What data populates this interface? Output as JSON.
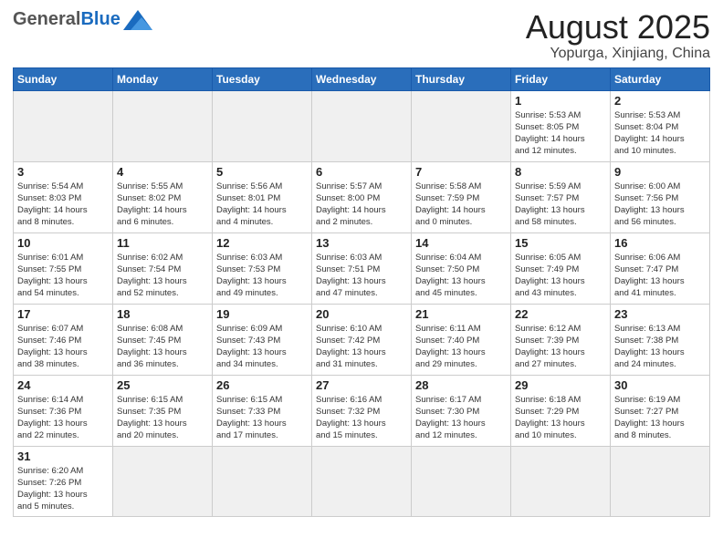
{
  "header": {
    "logo_general": "General",
    "logo_blue": "Blue",
    "month": "August 2025",
    "location": "Yopurga, Xinjiang, China"
  },
  "days_of_week": [
    "Sunday",
    "Monday",
    "Tuesday",
    "Wednesday",
    "Thursday",
    "Friday",
    "Saturday"
  ],
  "weeks": [
    [
      {
        "day": "",
        "info": ""
      },
      {
        "day": "",
        "info": ""
      },
      {
        "day": "",
        "info": ""
      },
      {
        "day": "",
        "info": ""
      },
      {
        "day": "",
        "info": ""
      },
      {
        "day": "1",
        "info": "Sunrise: 5:53 AM\nSunset: 8:05 PM\nDaylight: 14 hours\nand 12 minutes."
      },
      {
        "day": "2",
        "info": "Sunrise: 5:53 AM\nSunset: 8:04 PM\nDaylight: 14 hours\nand 10 minutes."
      }
    ],
    [
      {
        "day": "3",
        "info": "Sunrise: 5:54 AM\nSunset: 8:03 PM\nDaylight: 14 hours\nand 8 minutes."
      },
      {
        "day": "4",
        "info": "Sunrise: 5:55 AM\nSunset: 8:02 PM\nDaylight: 14 hours\nand 6 minutes."
      },
      {
        "day": "5",
        "info": "Sunrise: 5:56 AM\nSunset: 8:01 PM\nDaylight: 14 hours\nand 4 minutes."
      },
      {
        "day": "6",
        "info": "Sunrise: 5:57 AM\nSunset: 8:00 PM\nDaylight: 14 hours\nand 2 minutes."
      },
      {
        "day": "7",
        "info": "Sunrise: 5:58 AM\nSunset: 7:59 PM\nDaylight: 14 hours\nand 0 minutes."
      },
      {
        "day": "8",
        "info": "Sunrise: 5:59 AM\nSunset: 7:57 PM\nDaylight: 13 hours\nand 58 minutes."
      },
      {
        "day": "9",
        "info": "Sunrise: 6:00 AM\nSunset: 7:56 PM\nDaylight: 13 hours\nand 56 minutes."
      }
    ],
    [
      {
        "day": "10",
        "info": "Sunrise: 6:01 AM\nSunset: 7:55 PM\nDaylight: 13 hours\nand 54 minutes."
      },
      {
        "day": "11",
        "info": "Sunrise: 6:02 AM\nSunset: 7:54 PM\nDaylight: 13 hours\nand 52 minutes."
      },
      {
        "day": "12",
        "info": "Sunrise: 6:03 AM\nSunset: 7:53 PM\nDaylight: 13 hours\nand 49 minutes."
      },
      {
        "day": "13",
        "info": "Sunrise: 6:03 AM\nSunset: 7:51 PM\nDaylight: 13 hours\nand 47 minutes."
      },
      {
        "day": "14",
        "info": "Sunrise: 6:04 AM\nSunset: 7:50 PM\nDaylight: 13 hours\nand 45 minutes."
      },
      {
        "day": "15",
        "info": "Sunrise: 6:05 AM\nSunset: 7:49 PM\nDaylight: 13 hours\nand 43 minutes."
      },
      {
        "day": "16",
        "info": "Sunrise: 6:06 AM\nSunset: 7:47 PM\nDaylight: 13 hours\nand 41 minutes."
      }
    ],
    [
      {
        "day": "17",
        "info": "Sunrise: 6:07 AM\nSunset: 7:46 PM\nDaylight: 13 hours\nand 38 minutes."
      },
      {
        "day": "18",
        "info": "Sunrise: 6:08 AM\nSunset: 7:45 PM\nDaylight: 13 hours\nand 36 minutes."
      },
      {
        "day": "19",
        "info": "Sunrise: 6:09 AM\nSunset: 7:43 PM\nDaylight: 13 hours\nand 34 minutes."
      },
      {
        "day": "20",
        "info": "Sunrise: 6:10 AM\nSunset: 7:42 PM\nDaylight: 13 hours\nand 31 minutes."
      },
      {
        "day": "21",
        "info": "Sunrise: 6:11 AM\nSunset: 7:40 PM\nDaylight: 13 hours\nand 29 minutes."
      },
      {
        "day": "22",
        "info": "Sunrise: 6:12 AM\nSunset: 7:39 PM\nDaylight: 13 hours\nand 27 minutes."
      },
      {
        "day": "23",
        "info": "Sunrise: 6:13 AM\nSunset: 7:38 PM\nDaylight: 13 hours\nand 24 minutes."
      }
    ],
    [
      {
        "day": "24",
        "info": "Sunrise: 6:14 AM\nSunset: 7:36 PM\nDaylight: 13 hours\nand 22 minutes."
      },
      {
        "day": "25",
        "info": "Sunrise: 6:15 AM\nSunset: 7:35 PM\nDaylight: 13 hours\nand 20 minutes."
      },
      {
        "day": "26",
        "info": "Sunrise: 6:15 AM\nSunset: 7:33 PM\nDaylight: 13 hours\nand 17 minutes."
      },
      {
        "day": "27",
        "info": "Sunrise: 6:16 AM\nSunset: 7:32 PM\nDaylight: 13 hours\nand 15 minutes."
      },
      {
        "day": "28",
        "info": "Sunrise: 6:17 AM\nSunset: 7:30 PM\nDaylight: 13 hours\nand 12 minutes."
      },
      {
        "day": "29",
        "info": "Sunrise: 6:18 AM\nSunset: 7:29 PM\nDaylight: 13 hours\nand 10 minutes."
      },
      {
        "day": "30",
        "info": "Sunrise: 6:19 AM\nSunset: 7:27 PM\nDaylight: 13 hours\nand 8 minutes."
      }
    ],
    [
      {
        "day": "31",
        "info": "Sunrise: 6:20 AM\nSunset: 7:26 PM\nDaylight: 13 hours\nand 5 minutes."
      },
      {
        "day": "",
        "info": ""
      },
      {
        "day": "",
        "info": ""
      },
      {
        "day": "",
        "info": ""
      },
      {
        "day": "",
        "info": ""
      },
      {
        "day": "",
        "info": ""
      },
      {
        "day": "",
        "info": ""
      }
    ]
  ]
}
